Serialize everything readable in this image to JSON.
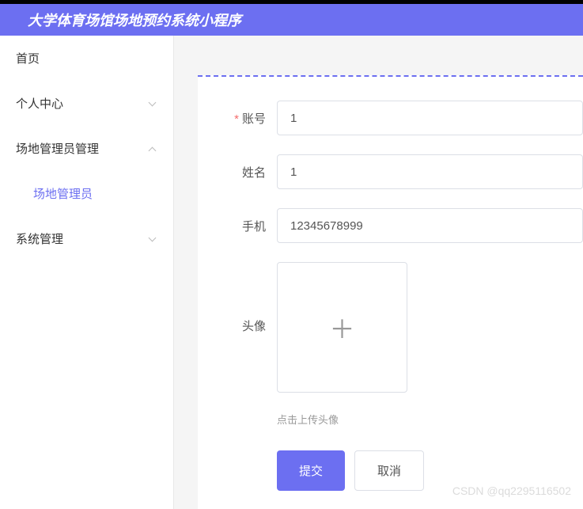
{
  "header": {
    "title": "大学体育场馆场地预约系统小程序"
  },
  "sidebar": {
    "items": [
      {
        "label": "首页",
        "expandable": false
      },
      {
        "label": "个人中心",
        "expandable": true,
        "expanded": false
      },
      {
        "label": "场地管理员管理",
        "expandable": true,
        "expanded": true
      },
      {
        "label": "场地管理员",
        "sub": true,
        "active": true
      },
      {
        "label": "系统管理",
        "expandable": true,
        "expanded": false
      }
    ]
  },
  "form": {
    "account": {
      "label": "账号",
      "value": "1",
      "required": true
    },
    "name": {
      "label": "姓名",
      "value": "1",
      "required": false
    },
    "phone": {
      "label": "手机",
      "value": "12345678999",
      "required": false
    },
    "avatar": {
      "label": "头像",
      "hint": "点击上传头像"
    },
    "submit": "提交",
    "cancel": "取消"
  },
  "watermark": "CSDN @qq2295116502"
}
